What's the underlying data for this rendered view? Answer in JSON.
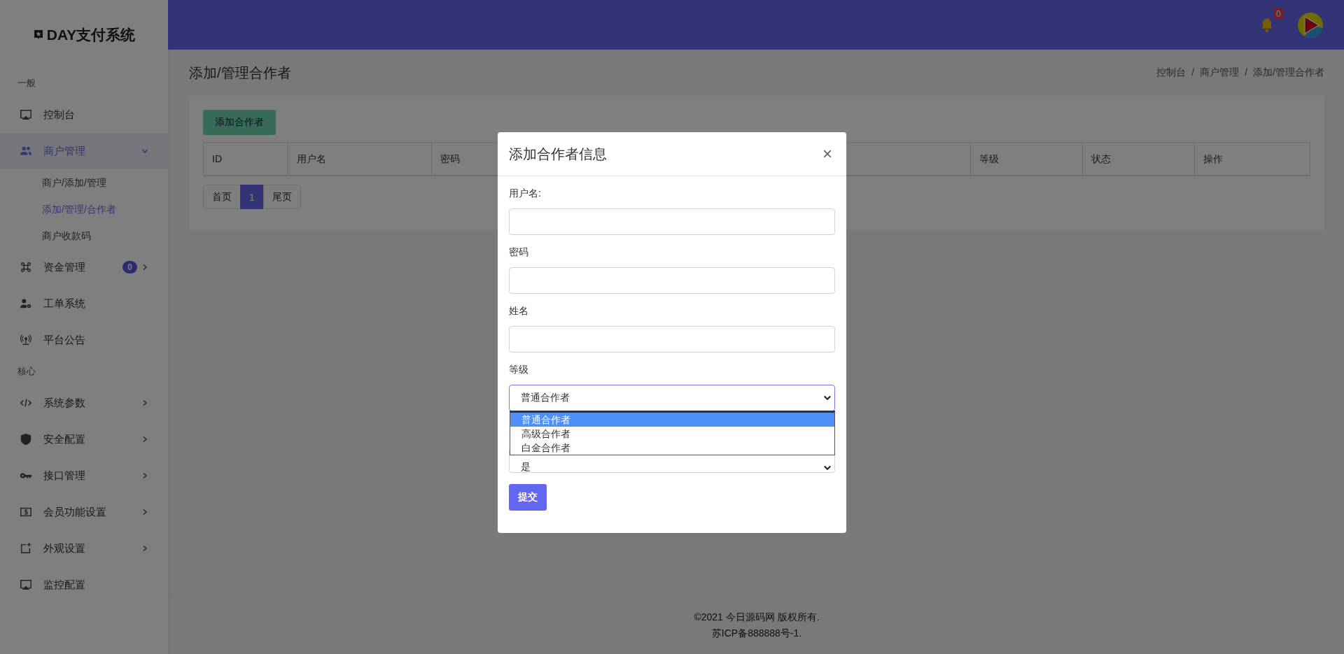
{
  "sidebar": {
    "logo": "DAY支付系统",
    "nav": [
      {
        "kind": "section",
        "label": "一般"
      },
      {
        "kind": "link",
        "label": "控制台",
        "selected": false
      },
      {
        "kind": "menu",
        "label": "商户管理",
        "selected": true,
        "expanded": true,
        "children": [
          {
            "label": "商户/添加/管理",
            "selected": false
          },
          {
            "label": "添加/管理/合作者",
            "selected": true
          },
          {
            "label": "商户收款码",
            "selected": false
          }
        ]
      },
      {
        "kind": "menu",
        "label": "资金管理",
        "selected": false,
        "expanded": false,
        "badge": "0"
      },
      {
        "kind": "link",
        "label": "工单系统",
        "selected": false
      },
      {
        "kind": "link",
        "label": "平台公告",
        "selected": false
      },
      {
        "kind": "section",
        "label": "核心"
      },
      {
        "kind": "menu",
        "label": "系统参数",
        "selected": false,
        "expanded": false
      },
      {
        "kind": "menu",
        "label": "安全配置",
        "selected": false,
        "expanded": false
      },
      {
        "kind": "menu",
        "label": "接口管理",
        "selected": false,
        "expanded": false
      },
      {
        "kind": "menu",
        "label": "会员功能设置",
        "selected": false,
        "expanded": false
      },
      {
        "kind": "menu",
        "label": "外观设置",
        "selected": false,
        "expanded": false
      },
      {
        "kind": "link",
        "label": "监控配置",
        "selected": false
      }
    ]
  },
  "header": {
    "notification_count": "0"
  },
  "page": {
    "title": "添加/管理合作者",
    "breadcrumb": [
      "控制台",
      "/",
      "商户管理",
      "/",
      "添加/管理合作者"
    ],
    "add_button": "添加合作者",
    "table": {
      "columns": [
        "ID",
        "用户名",
        "密码",
        "等级",
        "状态",
        "操作"
      ]
    },
    "pagination": [
      {
        "label": "首页",
        "selected": false
      },
      {
        "label": "1",
        "selected": true
      },
      {
        "label": "尾页",
        "selected": false
      }
    ]
  },
  "footer": [
    "©2021 今日源码网 版权所有.",
    "苏ICP备888888号-1."
  ],
  "modal": {
    "title": "添加合作者信息",
    "close": "×",
    "fields": [
      {
        "kind": "text",
        "label": "用户名:"
      },
      {
        "kind": "text",
        "label": "密码"
      },
      {
        "kind": "text",
        "label": "姓名"
      },
      {
        "kind": "select",
        "label": "等级",
        "value": "普通合作者",
        "open": true,
        "options": [
          {
            "label": "普通合作者",
            "selected": true
          },
          {
            "label": "高级合作者",
            "selected": false
          },
          {
            "label": "白金合作者",
            "selected": false
          }
        ]
      },
      {
        "kind": "select",
        "value": "是",
        "open": false
      }
    ],
    "submit": "提交"
  }
}
